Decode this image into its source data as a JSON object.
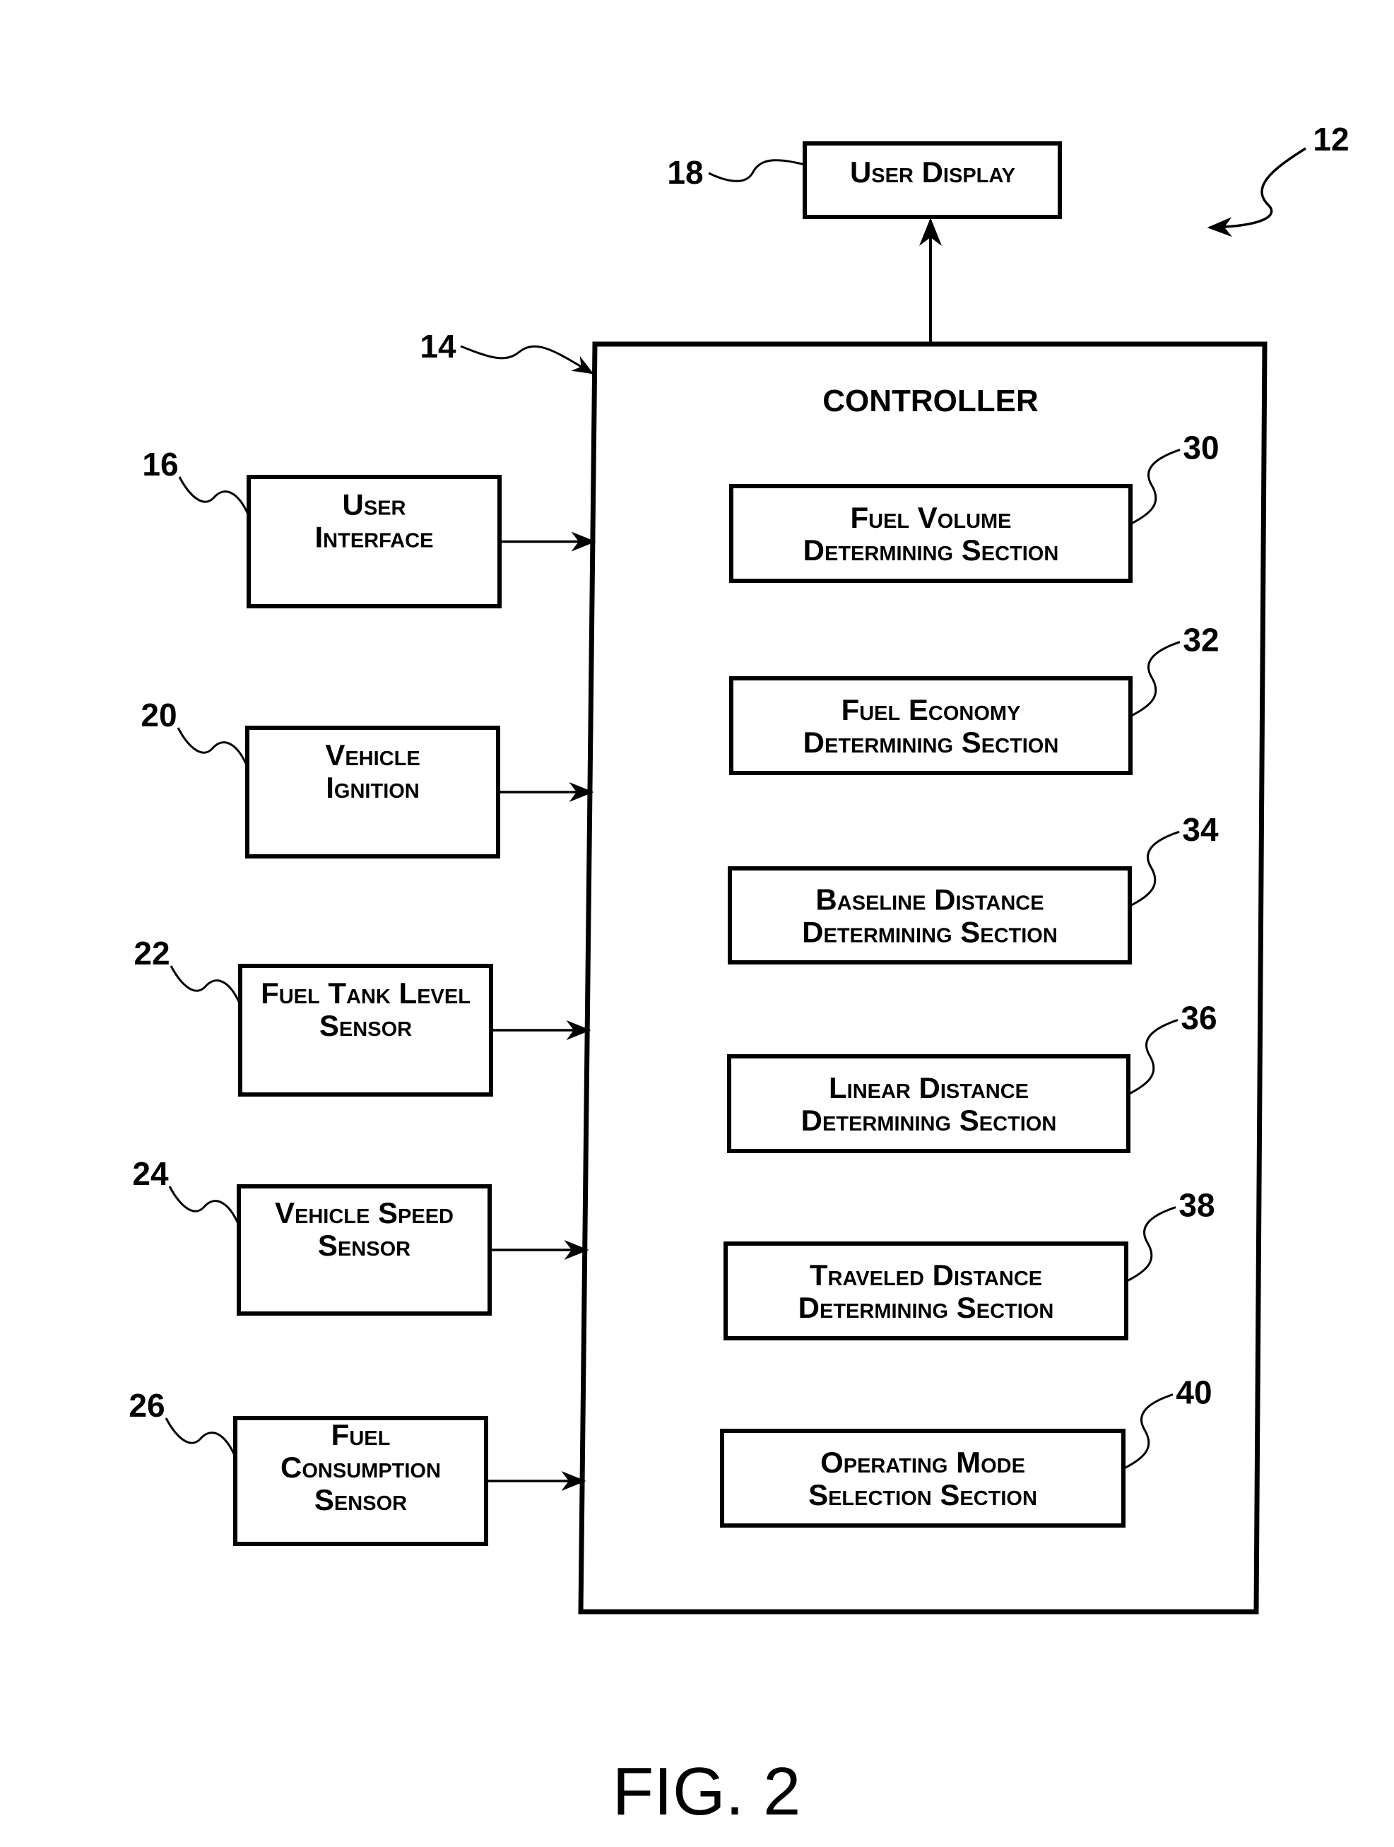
{
  "figure": {
    "caption": "FIG. 2",
    "system_ref": "12"
  },
  "output": {
    "ref": "18",
    "lines": [
      "User Display"
    ]
  },
  "controller": {
    "ref": "14",
    "label": "CONTROLLER",
    "sections": [
      {
        "ref": "30",
        "lines": [
          "Fuel Volume",
          "Determining Section"
        ]
      },
      {
        "ref": "32",
        "lines": [
          "Fuel Economy",
          "Determining Section"
        ]
      },
      {
        "ref": "34",
        "lines": [
          "Baseline Distance",
          "Determining Section"
        ]
      },
      {
        "ref": "36",
        "lines": [
          "Linear Distance",
          "Determining Section"
        ]
      },
      {
        "ref": "38",
        "lines": [
          "Traveled Distance",
          "Determining Section"
        ]
      },
      {
        "ref": "40",
        "lines": [
          "Operating Mode",
          "Selection Section"
        ]
      }
    ]
  },
  "inputs": [
    {
      "ref": "16",
      "lines": [
        "User",
        "Interface"
      ]
    },
    {
      "ref": "20",
      "lines": [
        "Vehicle",
        "Ignition"
      ]
    },
    {
      "ref": "22",
      "lines": [
        "Fuel Tank Level",
        "Sensor"
      ]
    },
    {
      "ref": "24",
      "lines": [
        "Vehicle Speed",
        "Sensor"
      ]
    },
    {
      "ref": "26",
      "lines": [
        "Fuel",
        "Consumption",
        "Sensor"
      ]
    }
  ],
  "colors": {
    "ink": "#000000",
    "paper": "#ffffff"
  }
}
